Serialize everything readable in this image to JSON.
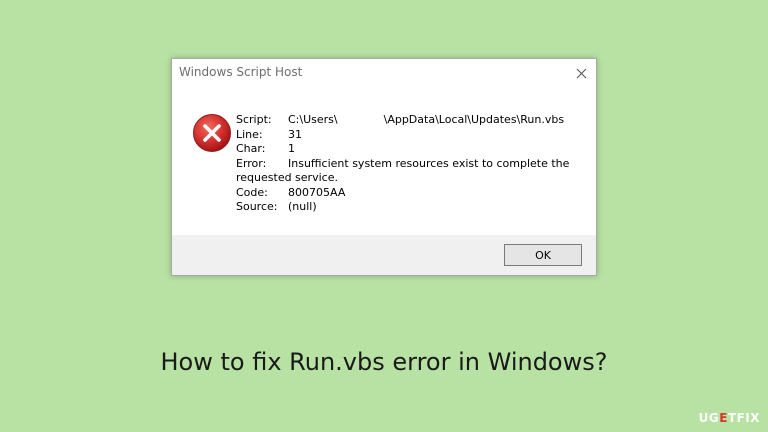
{
  "dialog": {
    "title": "Windows Script Host",
    "close_glyph": "✕",
    "details": {
      "script_label": "Script:",
      "script_value_prefix": "C:\\Users\\",
      "script_value_suffix": "\\AppData\\Local\\Updates\\Run.vbs",
      "line_label": "Line:",
      "line_value": "31",
      "char_label": "Char:",
      "char_value": "1",
      "error_label": "Error:",
      "error_value": "Insufficient system resources exist to complete the",
      "error_value_cont": "requested service.",
      "code_label": "Code:",
      "code_value": "800705AA",
      "source_label": "Source:",
      "source_value": "(null)"
    },
    "ok_label": "OK"
  },
  "headline": "How to fix Run.vbs error in Windows?",
  "logo": {
    "part1": "U",
    "part2": "G",
    "part3": "E",
    "part4": "T",
    "part5": "FIX"
  },
  "colors": {
    "background": "#b8e2a3",
    "error_icon": "#d32f2f",
    "logo_accent": "#d9362b"
  },
  "icons": {
    "error": "error-x-icon",
    "close": "close-icon"
  }
}
